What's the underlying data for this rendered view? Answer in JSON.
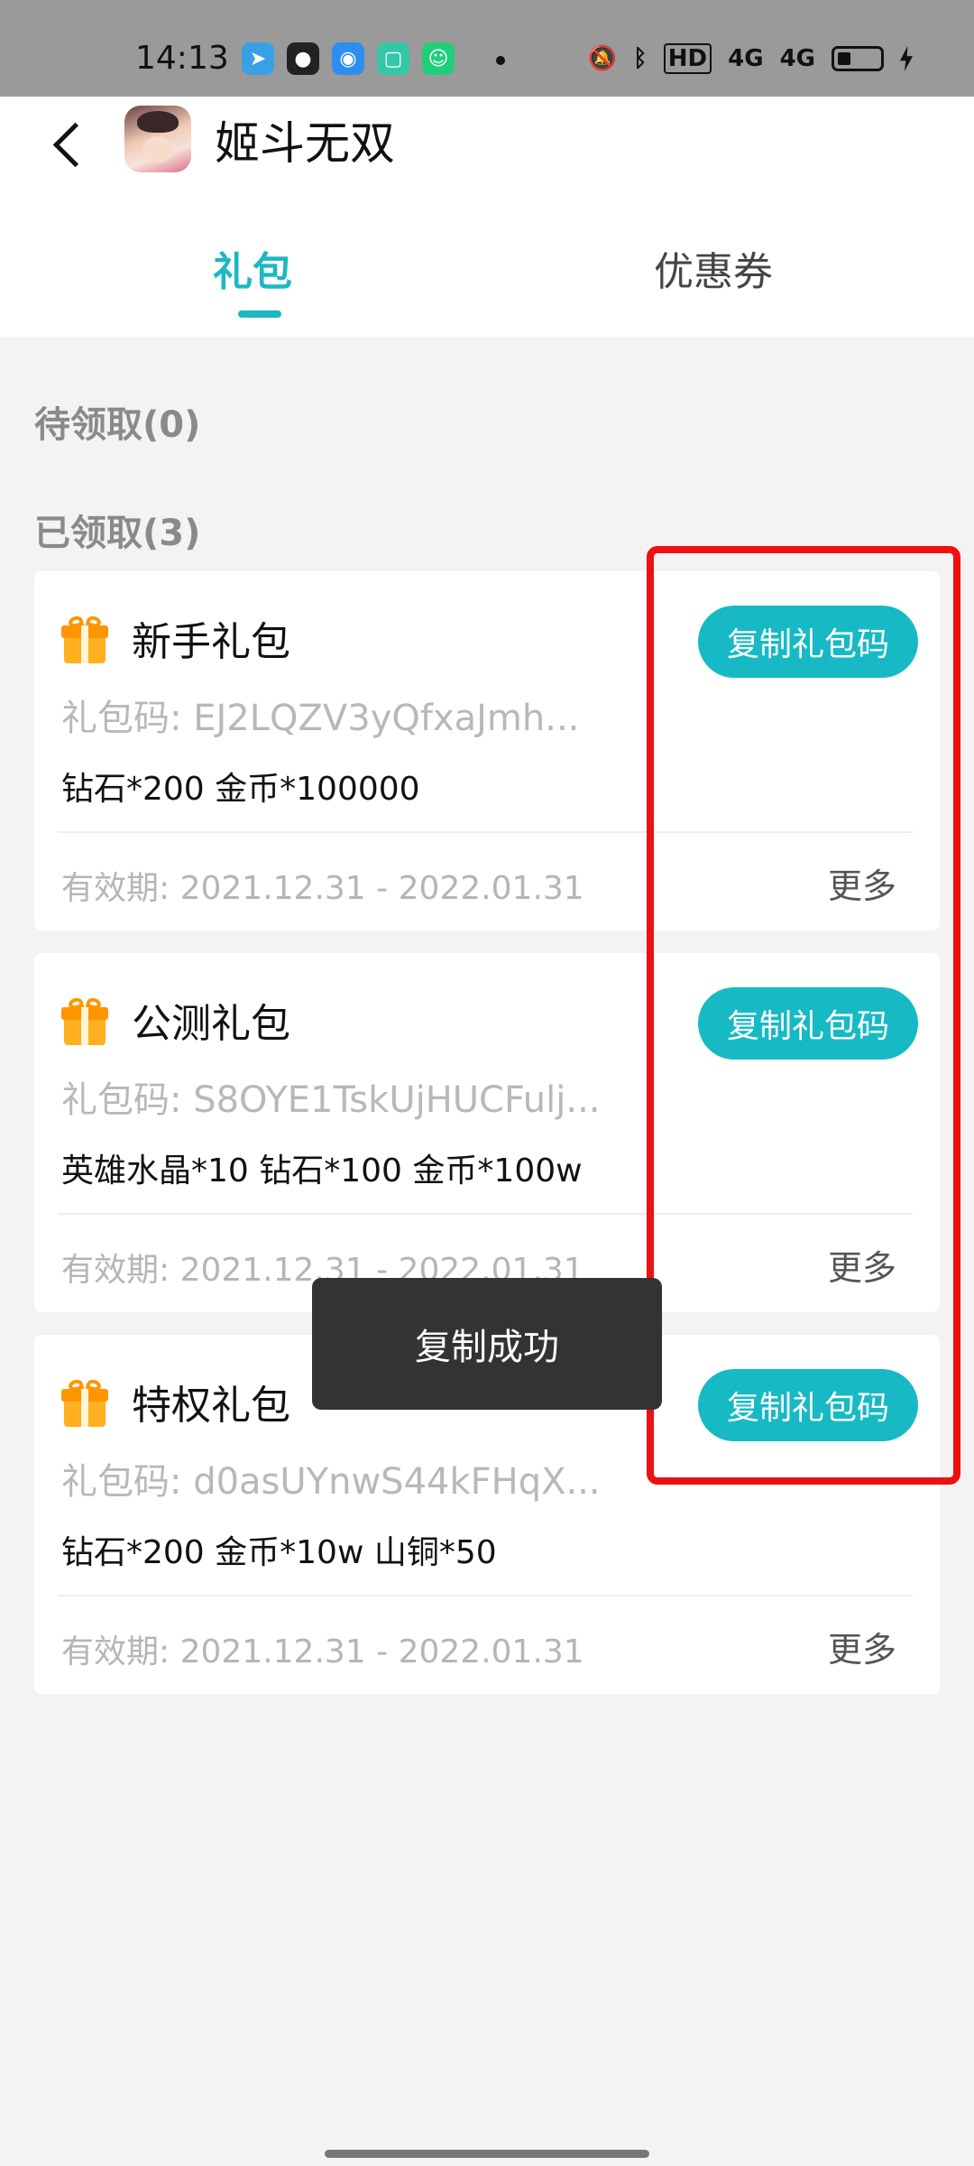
{
  "status_bar": {
    "time": "14:13",
    "apps": [
      {
        "icon": "telegram-icon",
        "color": "#3aa0e6",
        "glyph": "➤"
      },
      {
        "icon": "wechat-icon",
        "color": "#222222",
        "glyph": "●"
      },
      {
        "icon": "browser-icon",
        "color": "#2b8ef0",
        "glyph": "◉"
      },
      {
        "icon": "notes-app-icon",
        "color": "#33c7a7",
        "glyph": "▢"
      },
      {
        "icon": "android-app-icon",
        "color": "#1fcf7a",
        "glyph": "☺"
      }
    ],
    "right_icons": [
      "mute-vibrate-icon",
      "bluetooth-icon",
      "hd-icon",
      "signal-4g-icon",
      "signal-4g-icon",
      "battery-icon",
      "charging-icon"
    ],
    "hd_label": "HD",
    "signal_label_1": "4G",
    "signal_label_2": "4G"
  },
  "header": {
    "title": "姬斗无双",
    "back_icon": "chevron-left-icon"
  },
  "tabs": [
    {
      "label": "礼包",
      "active": true
    },
    {
      "label": "优惠券",
      "active": false
    }
  ],
  "sections": {
    "pending": "待领取(0)",
    "claimed": "已领取(3)"
  },
  "gift_cards": [
    {
      "title": "新手礼包",
      "code_label": "礼包码:",
      "code": "EJ2LQZV3yQfxaJmh...",
      "rewards": "钻石*200 金币*100000",
      "validity_label": "有效期:",
      "validity": "2021.12.31 - 2022.01.31",
      "more": "更多",
      "button": "复制礼包码"
    },
    {
      "title": "公测礼包",
      "code_label": "礼包码:",
      "code": "S8OYE1TskUjHUCFulj...",
      "rewards": "英雄水晶*10 钻石*100 金币*100w",
      "validity_label": "有效期:",
      "validity": "2021.12.31 - 2022.01.31",
      "more": "更多",
      "button": "复制礼包码"
    },
    {
      "title": "特权礼包",
      "code_label": "礼包码:",
      "code": "d0asUYnwS44kFHqX...",
      "rewards": "钻石*200 金币*10w 山铜*50",
      "validity_label": "有效期:",
      "validity": "2021.12.31 - 2022.01.31",
      "more": "更多",
      "button": "复制礼包码"
    }
  ],
  "toast": "复制成功",
  "colors": {
    "accent": "#17bac4",
    "highlight": "#ee1111",
    "gift_icon": "#ffb020"
  }
}
